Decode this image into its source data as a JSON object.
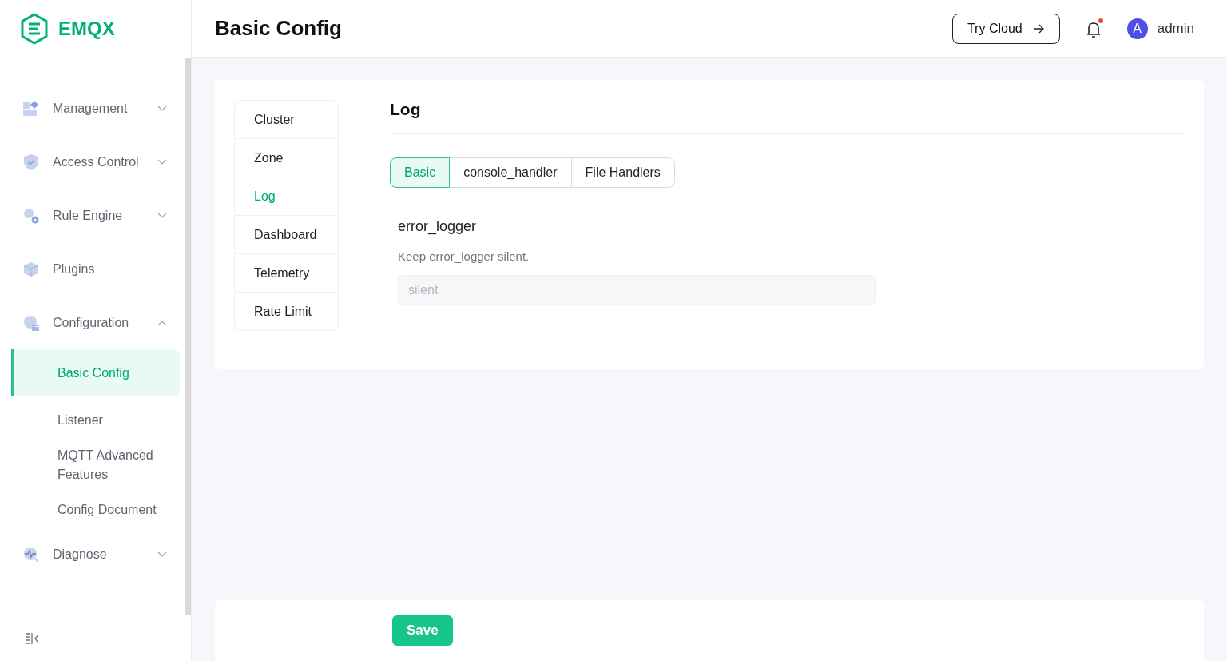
{
  "brand": "EMQX",
  "page_title": "Basic Config",
  "header": {
    "try_cloud": "Try Cloud",
    "notification_dot": true,
    "avatar_letter": "A",
    "user": "admin"
  },
  "sidebar": {
    "items": [
      {
        "label": "Management",
        "expanded": false
      },
      {
        "label": "Access Control",
        "expanded": false
      },
      {
        "label": "Rule Engine",
        "expanded": false
      },
      {
        "label": "Plugins"
      },
      {
        "label": "Configuration",
        "expanded": true,
        "children": [
          {
            "label": "Basic Config",
            "selected": true
          },
          {
            "label": "Listener",
            "selected": false
          },
          {
            "label": "MQTT Advanced Features",
            "selected": false
          },
          {
            "label": "Config Document",
            "selected": false
          }
        ]
      },
      {
        "label": "Diagnose",
        "expanded": false
      }
    ]
  },
  "config_menu": [
    {
      "label": "Cluster",
      "selected": false
    },
    {
      "label": "Zone",
      "selected": false
    },
    {
      "label": "Log",
      "selected": true
    },
    {
      "label": "Dashboard",
      "selected": false
    },
    {
      "label": "Telemetry",
      "selected": false
    },
    {
      "label": "Rate Limit",
      "selected": false
    }
  ],
  "section_title": "Log",
  "tabs": [
    {
      "label": "Basic",
      "selected": true
    },
    {
      "label": "console_handler",
      "selected": false
    },
    {
      "label": "File Handlers",
      "selected": false
    }
  ],
  "fields": [
    {
      "label": "error_logger",
      "description": "Keep error_logger silent.",
      "value": "silent",
      "disabled": true
    }
  ],
  "save": "Save"
}
